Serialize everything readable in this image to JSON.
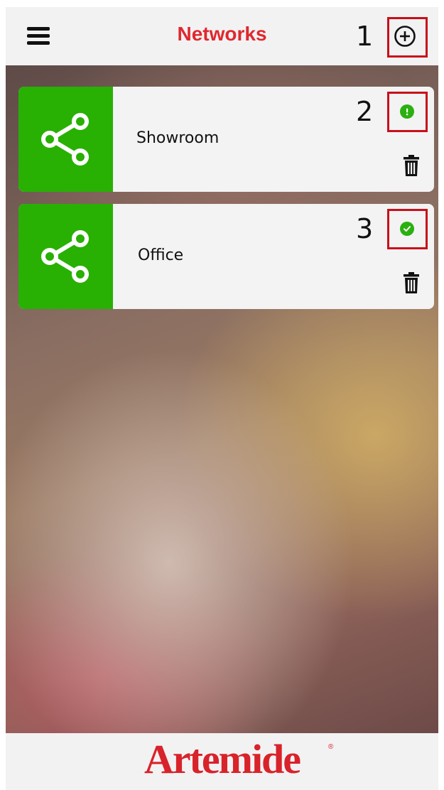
{
  "header": {
    "title": "Networks",
    "menu_icon": "hamburger-menu-icon",
    "add_icon": "plus-circle-icon"
  },
  "annotations": [
    "1",
    "2",
    "3"
  ],
  "networks": [
    {
      "name": "Showroom",
      "status": "warning",
      "status_icon": "exclamation-icon",
      "delete_icon": "trash-icon",
      "tile_icon": "share-network-icon"
    },
    {
      "name": "Office",
      "status": "ok",
      "status_icon": "checkmark-icon",
      "delete_icon": "trash-icon",
      "tile_icon": "share-network-icon"
    }
  ],
  "footer": {
    "brand": "Artemide",
    "registered_mark": "®"
  },
  "colors": {
    "accent_red": "#e0282d",
    "tile_green": "#28b003",
    "status_green": "#2ab00f",
    "annotation_red": "#c8101a"
  }
}
